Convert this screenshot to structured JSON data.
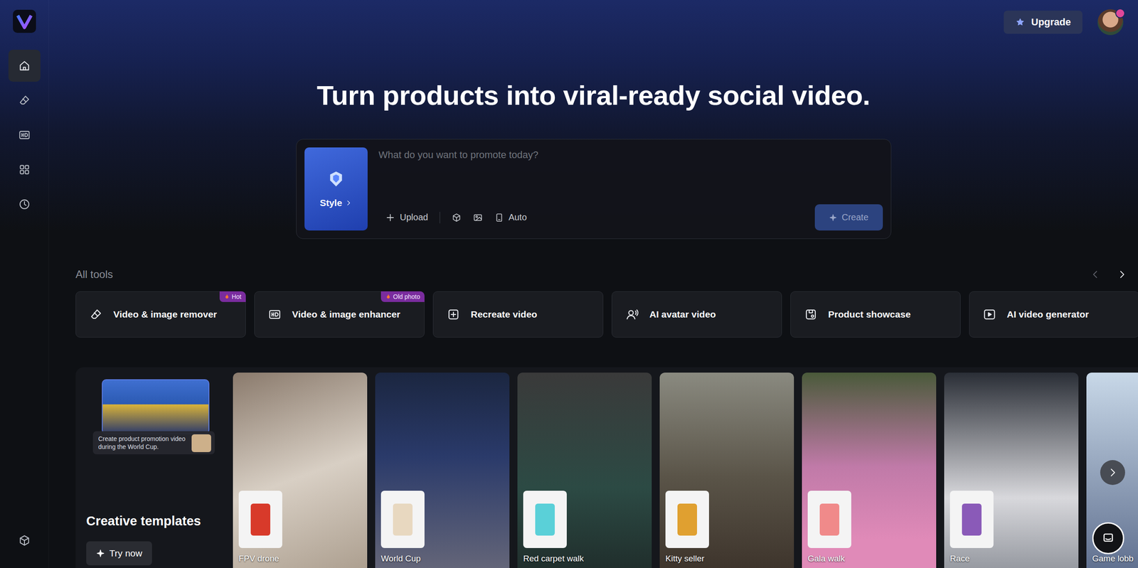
{
  "header": {
    "upgrade": "Upgrade"
  },
  "sidebar": {
    "items": [
      {
        "selected": true
      },
      {
        "selected": false
      },
      {
        "selected": false
      },
      {
        "selected": false
      },
      {
        "selected": false
      },
      {
        "selected": false
      }
    ]
  },
  "hero": {
    "title": "Turn products into viral-ready social video.",
    "prompt": {
      "placeholder": "What do you want to promote today?",
      "style": "Style",
      "upload": "Upload",
      "mode": "Auto",
      "create": "Create",
      "create_disabled": true
    }
  },
  "tools": {
    "heading": "All tools",
    "items": [
      {
        "label": "Video & image remover",
        "badge": "Hot"
      },
      {
        "label": "Video & image enhancer",
        "badge": "Old photo"
      },
      {
        "label": "Recreate video",
        "badge": ""
      },
      {
        "label": "AI avatar video",
        "badge": ""
      },
      {
        "label": "Product showcase",
        "badge": ""
      },
      {
        "label": "AI video generator",
        "badge": ""
      }
    ]
  },
  "templates": {
    "title": "Creative templates",
    "action": "Try now",
    "tooltip": "Create product promotion video during the World Cup.",
    "items": [
      {
        "label": "FPV drone"
      },
      {
        "label": "World Cup"
      },
      {
        "label": "Red carpet walk"
      },
      {
        "label": "Kitty seller"
      },
      {
        "label": "Gala walk"
      },
      {
        "label": "Race"
      },
      {
        "label": "Game lobb"
      }
    ]
  }
}
